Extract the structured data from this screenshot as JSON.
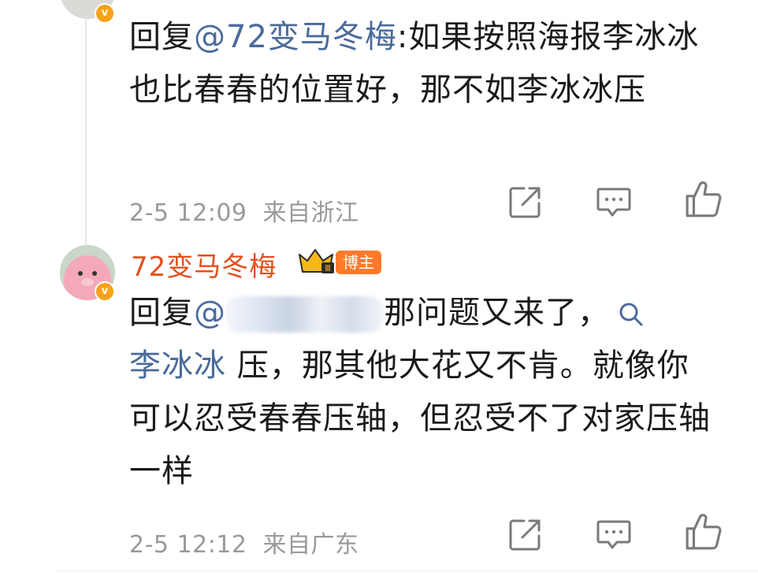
{
  "comment_prev": {
    "verified_badge": "v",
    "reply_prefix": "回复",
    "mention": "@72变马冬梅",
    "separator": ":",
    "text": "如果按照海报李冰冰也比春春的位置好，那不如李冰冰压",
    "time": "2-5 12:09",
    "location": "来自浙江"
  },
  "comment_main": {
    "username": "72变马冬梅",
    "verified_badge": "v",
    "level_badge": "Ⅲ",
    "role_badge": "博主",
    "reply_prefix": "回复",
    "mention_start": "@",
    "text_1": "那问题又来了，",
    "search_link": "李冰冰",
    "text_2": " 压，那其他大花又不肯。就像你可以忍受春春压轴，但忍受不了对家压轴一样",
    "time": "2-5 12:12",
    "location": "来自广东"
  },
  "colors": {
    "mention": "#4a6b9b",
    "username": "#e2501e",
    "badge": "#ff7a2a",
    "meta": "#9a9a9a"
  },
  "icons": [
    "share-icon",
    "comment-icon",
    "like-icon",
    "search-icon",
    "crown-icon"
  ]
}
